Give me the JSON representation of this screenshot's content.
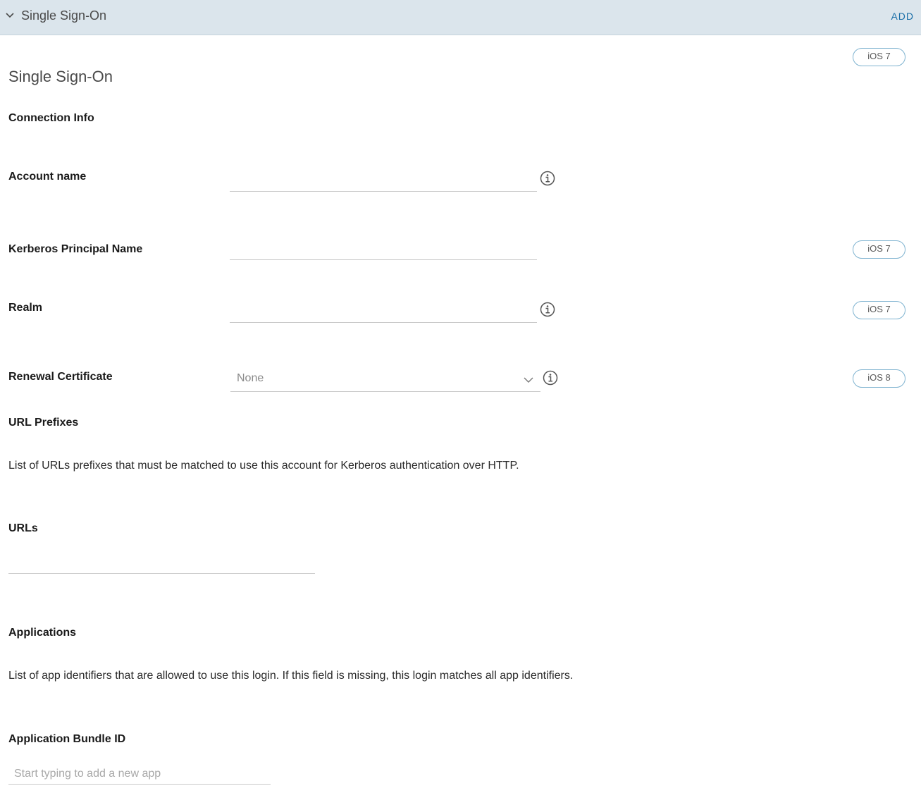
{
  "header": {
    "title": "Single Sign-On",
    "add_label": "ADD"
  },
  "section": {
    "title": "Single Sign-On",
    "badge": "iOS 7"
  },
  "connection_info": {
    "heading": "Connection Info"
  },
  "account_name": {
    "label": "Account name",
    "value": ""
  },
  "kerberos": {
    "label": "Kerberos Principal Name",
    "value": "",
    "badge": "iOS 7"
  },
  "realm": {
    "label": "Realm",
    "value": "",
    "badge": "iOS 7"
  },
  "renewal_certificate": {
    "label": "Renewal Certificate",
    "selected": "None",
    "badge": "iOS 8"
  },
  "url_prefixes": {
    "heading": "URL Prefixes",
    "description": "List of URLs prefixes that must be matched to use this account for Kerberos authentication over HTTP."
  },
  "urls": {
    "label": "URLs",
    "value": ""
  },
  "applications": {
    "heading": "Applications",
    "description": "List of app identifiers that are allowed to use this login. If this field is missing, this login matches all app identifiers."
  },
  "bundle_id": {
    "label": "Application Bundle ID",
    "placeholder": "Start typing to add a new app"
  },
  "icons": {
    "collapse": "chevron-down-icon",
    "info": "info-circle-icon",
    "dropdown": "chevron-down-icon"
  },
  "colors": {
    "header_bg": "#dbe5ec",
    "accent": "#1b6fa8",
    "badge_border": "#7fb3d0"
  }
}
